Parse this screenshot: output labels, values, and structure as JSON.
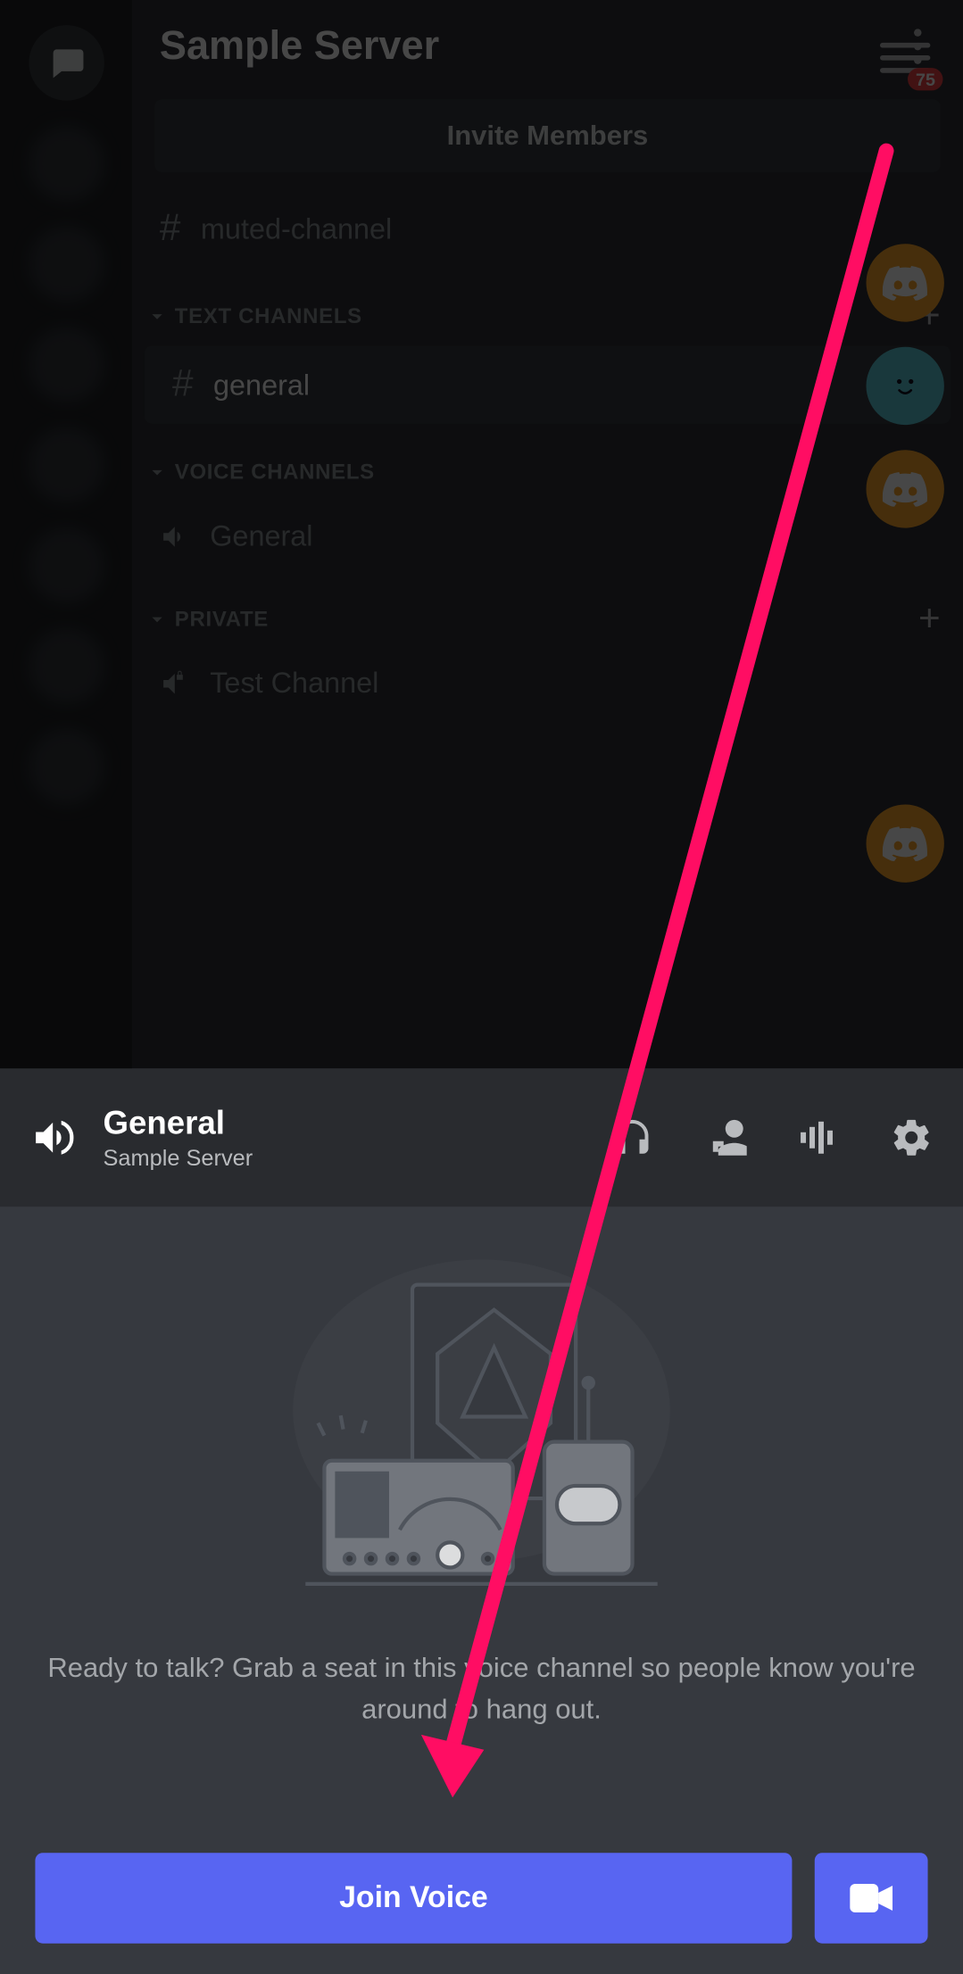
{
  "server": {
    "name": "Sample Server"
  },
  "topbar": {
    "invite_label": "Invite Members",
    "notification_count": "75"
  },
  "channels": {
    "loose": [
      {
        "name": "muted-channel"
      }
    ],
    "categories": [
      {
        "label": "TEXT CHANNELS",
        "items": [
          {
            "name": "general",
            "selected": true
          }
        ]
      },
      {
        "label": "VOICE CHANNELS",
        "items": [
          {
            "name": "General"
          }
        ]
      },
      {
        "label": "PRIVATE",
        "items": [
          {
            "name": "Test Channel",
            "locked": true
          }
        ]
      }
    ]
  },
  "voicebar": {
    "channel": "General",
    "server": "Sample Server"
  },
  "promo": {
    "text": "Ready to talk? Grab a seat in this voice channel so people know you're around to hang out.",
    "join_label": "Join Voice"
  }
}
